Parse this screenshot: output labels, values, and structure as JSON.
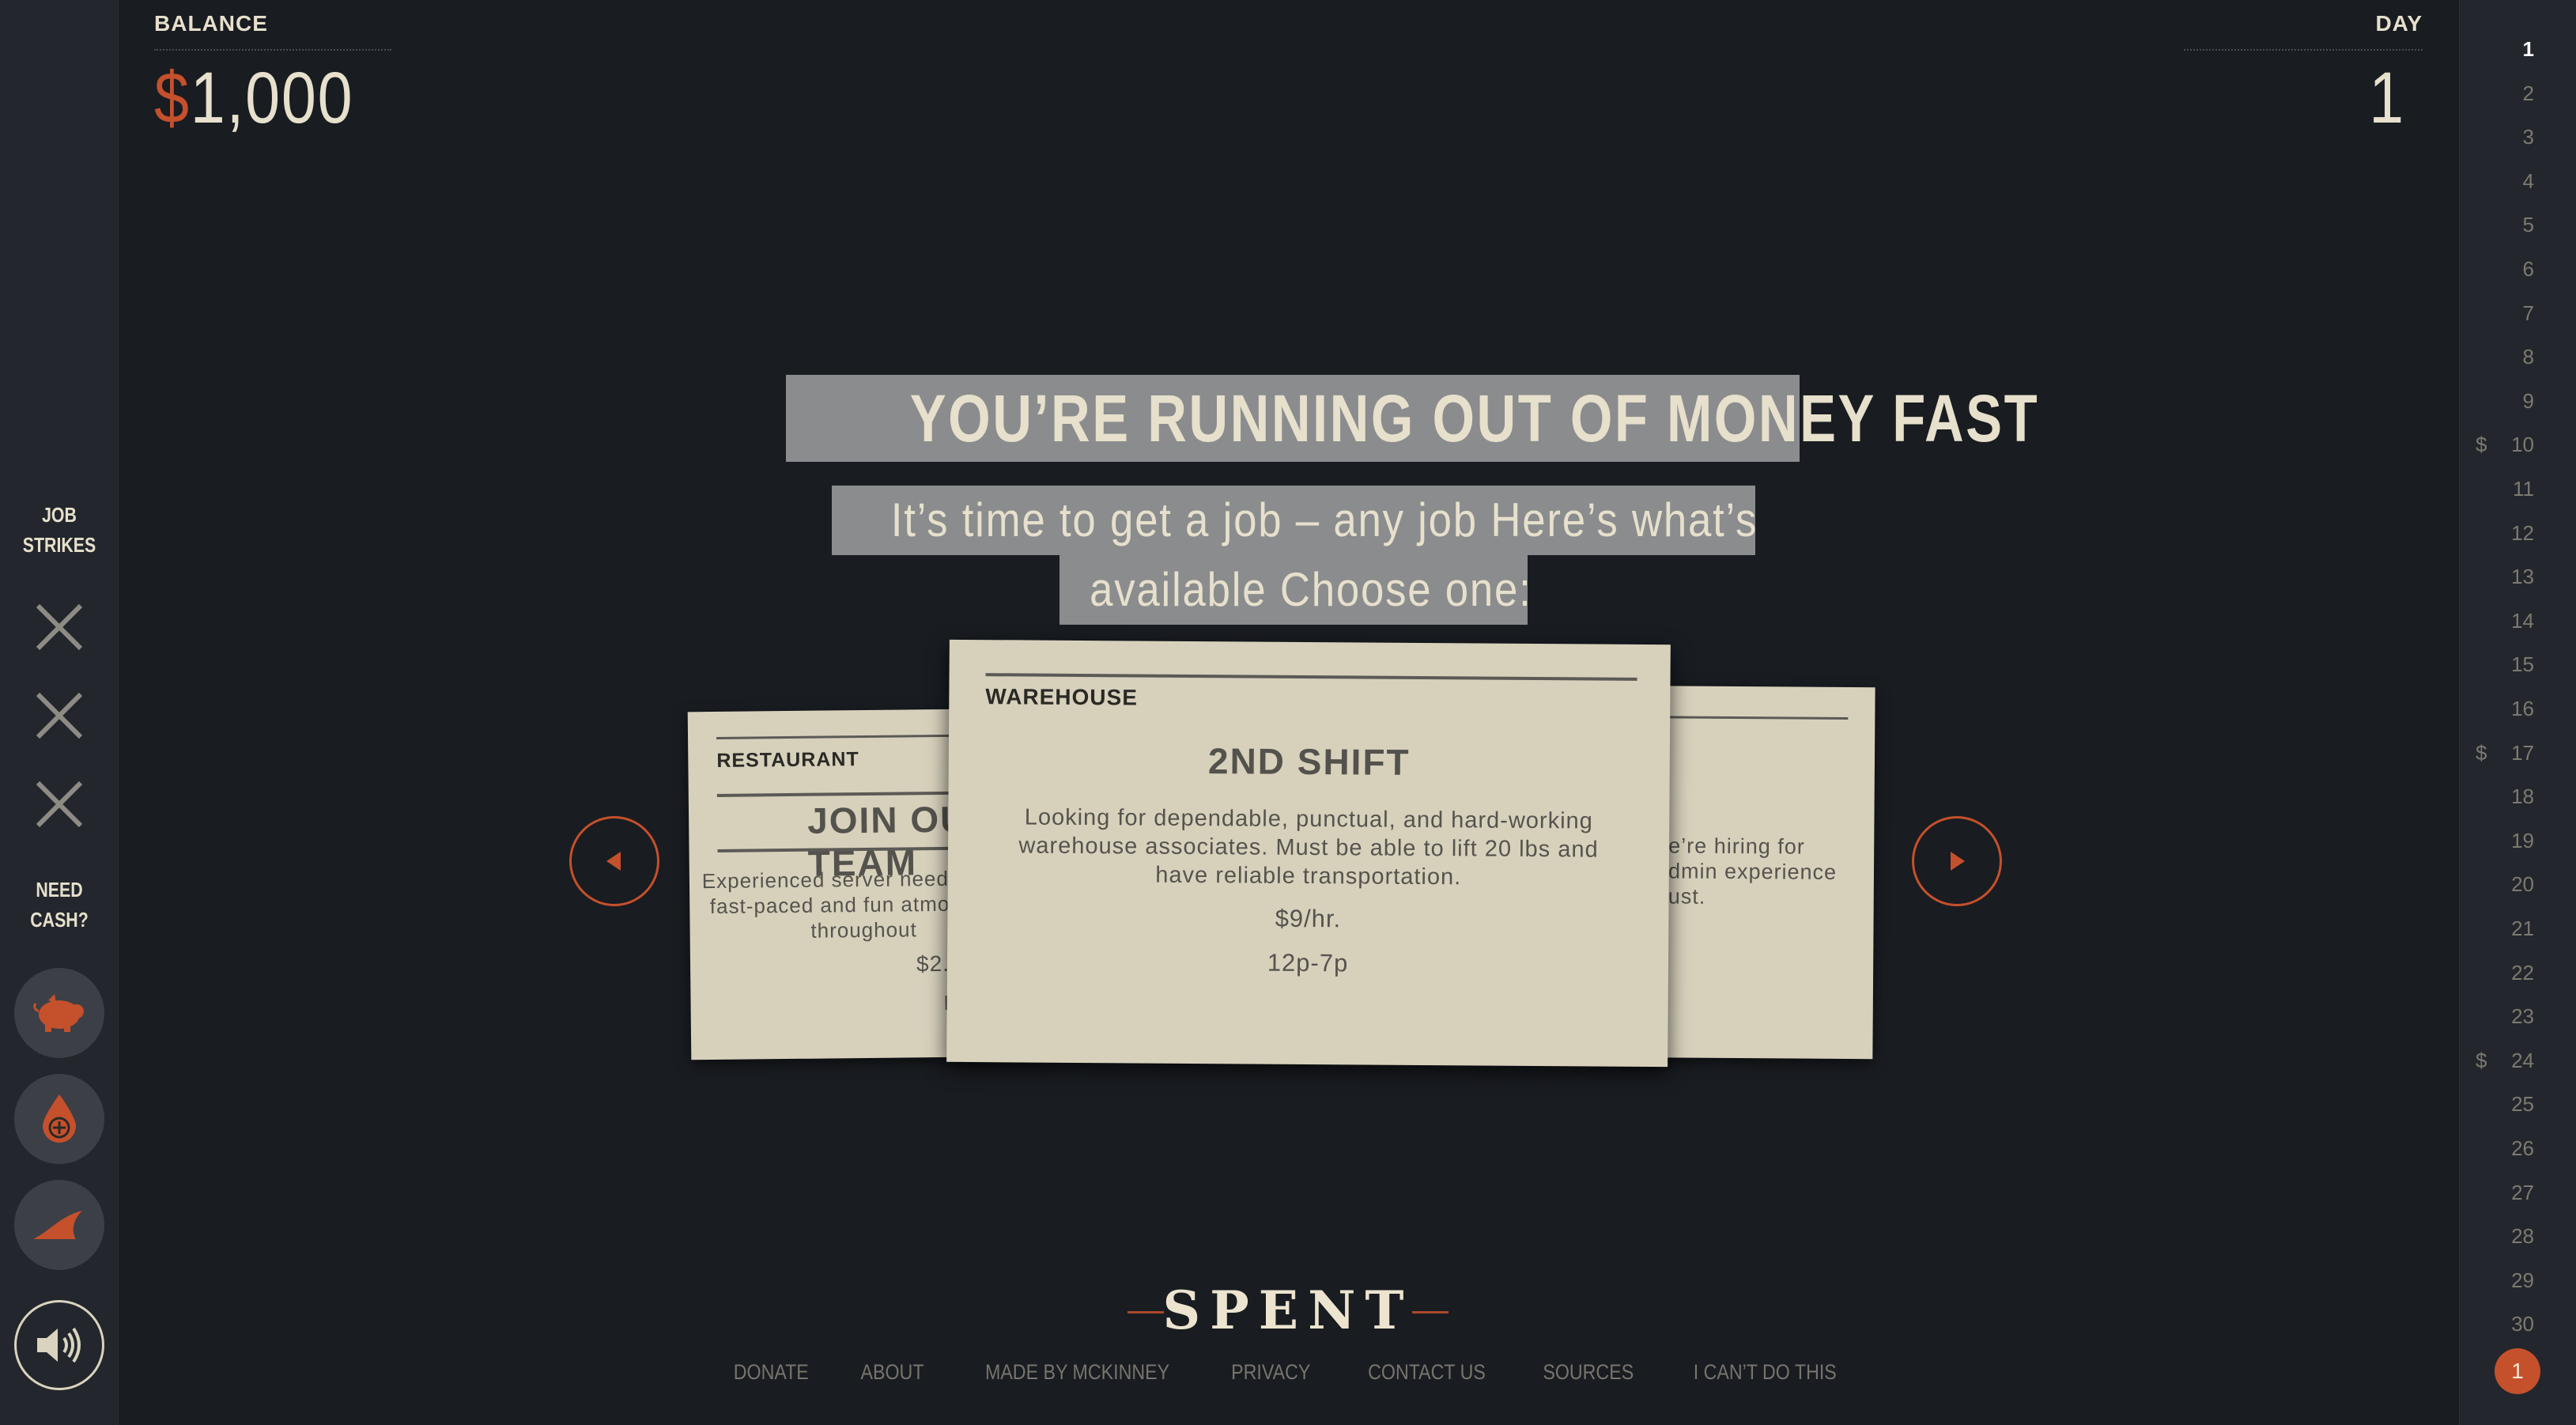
{
  "stats": {
    "balance_label": "BALANCE",
    "balance_currency": "$",
    "balance_amount": "1,000",
    "day_label": "DAY",
    "day_value": "1"
  },
  "sidebar": {
    "job_strikes_label": [
      "JOB",
      "STRIKES"
    ],
    "strike_count": 3,
    "need_cash_label": [
      "NEED",
      "CASH?"
    ],
    "cash_options": [
      "piggy-bank-icon",
      "blood-drop-icon",
      "loan-shark-fin-icon"
    ],
    "sound_icon": "speaker-icon"
  },
  "headline": "YOU’RE RUNNING OUT OF MONEY FAST",
  "subline": [
    "It’s time to get a job – any job Here’s what’s",
    "available Choose one:"
  ],
  "cards": {
    "left": {
      "category": "RESTAURANT",
      "title": "JOIN OUR TEAM",
      "desc": [
        "Experienced server needed for a",
        "fast-paced and fun atmosphere",
        "throughout"
      ],
      "pay": "$2.",
      "hours": "H"
    },
    "center": {
      "category": "WAREHOUSE",
      "title": "2ND SHIFT",
      "desc": [
        "Looking for dependable, punctual, and hard-working",
        "warehouse associates. Must be able to lift 20 lbs and",
        "have reliable transportation."
      ],
      "pay": "$9/hr.",
      "hours": "12p-7p"
    },
    "right": {
      "desc": [
        "e’re hiring for",
        "dmin experience",
        "ust."
      ]
    }
  },
  "days": [
    "1",
    "2",
    "3",
    "4",
    "5",
    "6",
    "7",
    "8",
    "9",
    "10",
    "11",
    "12",
    "13",
    "14",
    "15",
    "16",
    "17",
    "18",
    "19",
    "20",
    "21",
    "22",
    "23",
    "24",
    "25",
    "26",
    "27",
    "28",
    "29",
    "30"
  ],
  "payday_marker": "$",
  "payday_days": [
    "10",
    "17",
    "24"
  ],
  "current_day": "1",
  "logo": "SPENT",
  "footer": [
    "DONATE",
    "ABOUT",
    "MADE BY MCKINNEY",
    "PRIVACY",
    "CONTACT US",
    "SOURCES",
    "I CAN’T DO THIS"
  ],
  "colors": {
    "accent": "#c4502c",
    "background": "#191c21",
    "card": "#d7d1bc",
    "text": "#e6e0cc"
  }
}
